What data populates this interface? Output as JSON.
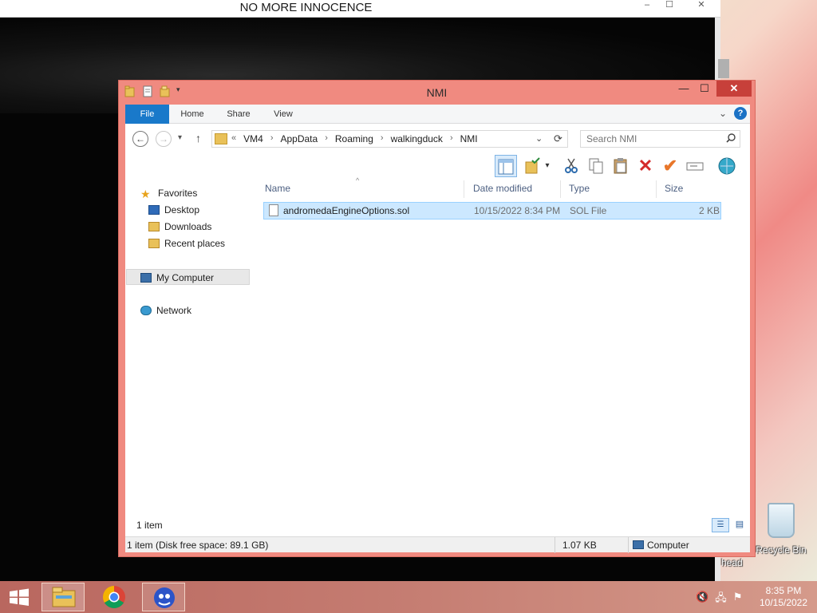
{
  "background_window": {
    "title": "NO MORE INNOCENCE",
    "minimize": "–",
    "maximize": "☐",
    "close": "✕"
  },
  "explorer": {
    "title": "NMI",
    "window_controls": {
      "minimize": "—",
      "maximize": "☐",
      "close": "✕"
    },
    "ribbon": {
      "tabs": [
        "File",
        "Home",
        "Share",
        "View"
      ],
      "expand": "⌄",
      "help": "?"
    },
    "navigation": {
      "back": "←",
      "forward": "→",
      "recent": "▾",
      "up": "↑",
      "address_prefix": "«",
      "breadcrumbs": [
        "VM4",
        "AppData",
        "Roaming",
        "walkingduck",
        "NMI"
      ],
      "separator": "›",
      "dropdown": "⌄",
      "refresh": "⟳",
      "search_placeholder": "Search NMI"
    },
    "nav_pane": {
      "favorites": "Favorites",
      "desktop": "Desktop",
      "downloads": "Downloads",
      "recent_places": "Recent places",
      "my_computer": "My Computer",
      "network": "Network"
    },
    "columns": {
      "name": "Name",
      "date_modified": "Date modified",
      "type": "Type",
      "size": "Size"
    },
    "files": [
      {
        "name": "andromedaEngineOptions.sol",
        "date_modified": "10/15/2022 8:34 PM",
        "type": "SOL File",
        "size": "2 KB"
      }
    ],
    "item_count": "1 item",
    "statusbar": {
      "disk": "1 item (Disk free space: 89.1 GB)",
      "size": "1.07 KB",
      "location": "Computer"
    }
  },
  "desktop": {
    "recycle_bin": "Recycle Bin",
    "head_label": "head"
  },
  "taskbar": {
    "time": "8:35 PM",
    "date": "10/15/2022"
  },
  "colors": {
    "accent_file_tab": "#1979ca",
    "window_frame": "#f08a80",
    "selection": "#cce8ff"
  }
}
